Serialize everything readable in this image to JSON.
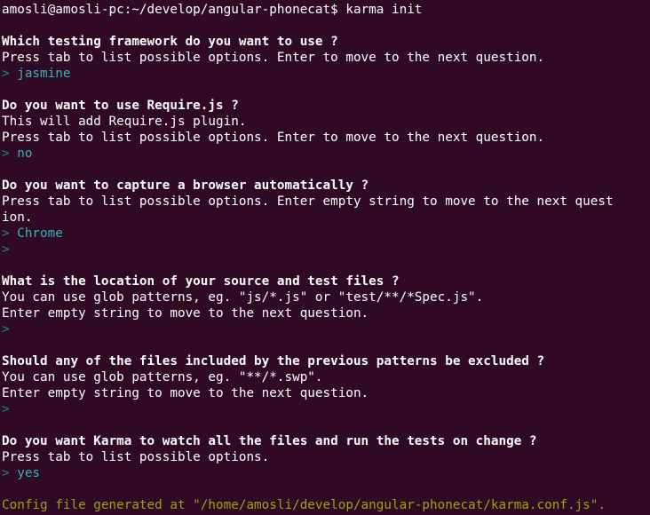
{
  "terminal": {
    "background_color": "#300a24",
    "default_text_color": "#ffffff",
    "bold_text_color": "#ffffff",
    "answer_color": "#34b5b8",
    "prompt_marker_color": "#2a7e86",
    "success_color": "#99a60b",
    "columns": 80,
    "rows": 32,
    "prompt_marker": ">"
  },
  "shell": {
    "prompt": "amosli@amosli-pc:~/develop/angular-phonecat$",
    "command": "karma init",
    "user": "amosli",
    "host": "amosli-pc",
    "cwd": "~/develop/angular-phonecat"
  },
  "lines": [
    {
      "id": "l00",
      "style": "default",
      "text": "amosli@amosli-pc:~/develop/angular-phonecat$ karma init"
    },
    {
      "id": "l01",
      "style": "blank",
      "text": ""
    },
    {
      "id": "l02",
      "style": "bold",
      "text": "Which testing framework do you want to use ?"
    },
    {
      "id": "l03",
      "style": "default",
      "text": "Press tab to list possible options. Enter to move to the next question."
    },
    {
      "id": "l04",
      "style": "answer",
      "marker": "> ",
      "text": "jasmine"
    },
    {
      "id": "l05",
      "style": "blank",
      "text": ""
    },
    {
      "id": "l06",
      "style": "bold",
      "text": "Do you want to use Require.js ?"
    },
    {
      "id": "l07",
      "style": "default",
      "text": "This will add Require.js plugin."
    },
    {
      "id": "l08",
      "style": "default",
      "text": "Press tab to list possible options. Enter to move to the next question."
    },
    {
      "id": "l09",
      "style": "answer",
      "marker": "> ",
      "text": "no"
    },
    {
      "id": "l10",
      "style": "blank",
      "text": ""
    },
    {
      "id": "l11",
      "style": "bold",
      "text": "Do you want to capture a browser automatically ?"
    },
    {
      "id": "l12",
      "style": "default",
      "text": "Press tab to list possible options. Enter empty string to move to the next quest"
    },
    {
      "id": "l13",
      "style": "default",
      "text": "ion."
    },
    {
      "id": "l14",
      "style": "answer",
      "marker": "> ",
      "text": "Chrome"
    },
    {
      "id": "l15",
      "style": "answer",
      "marker": ">",
      "text": ""
    },
    {
      "id": "l16",
      "style": "blank",
      "text": ""
    },
    {
      "id": "l17",
      "style": "bold",
      "text": "What is the location of your source and test files ?"
    },
    {
      "id": "l18",
      "style": "default",
      "text": "You can use glob patterns, eg. \"js/*.js\" or \"test/**/*Spec.js\"."
    },
    {
      "id": "l19",
      "style": "default",
      "text": "Enter empty string to move to the next question."
    },
    {
      "id": "l20",
      "style": "answer",
      "marker": ">",
      "text": ""
    },
    {
      "id": "l21",
      "style": "blank",
      "text": ""
    },
    {
      "id": "l22",
      "style": "bold",
      "text": "Should any of the files included by the previous patterns be excluded ?"
    },
    {
      "id": "l23",
      "style": "default",
      "text": "You can use glob patterns, eg. \"**/*.swp\"."
    },
    {
      "id": "l24",
      "style": "default",
      "text": "Enter empty string to move to the next question."
    },
    {
      "id": "l25",
      "style": "answer",
      "marker": ">",
      "text": ""
    },
    {
      "id": "l26",
      "style": "blank",
      "text": ""
    },
    {
      "id": "l27",
      "style": "bold",
      "text": "Do you want Karma to watch all the files and run the tests on change ?"
    },
    {
      "id": "l28",
      "style": "default",
      "text": "Press tab to list possible options."
    },
    {
      "id": "l29",
      "style": "answer",
      "marker": "> ",
      "text": "yes"
    },
    {
      "id": "l30",
      "style": "blank",
      "text": ""
    },
    {
      "id": "l31",
      "style": "success",
      "text": "Config file generated at \"/home/amosli/develop/angular-phonecat/karma.conf.js\"."
    }
  ],
  "session": {
    "tool": "karma init",
    "questions": [
      {
        "prompt": "Which testing framework do you want to use ?",
        "hint": "Press tab to list possible options. Enter to move to the next question.",
        "answer": "jasmine"
      },
      {
        "prompt": "Do you want to use Require.js ?",
        "hint": "This will add Require.js plugin.",
        "hint2": "Press tab to list possible options. Enter to move to the next question.",
        "answer": "no"
      },
      {
        "prompt": "Do you want to capture a browser automatically ?",
        "hint": "Press tab to list possible options. Enter empty string to move to the next question.",
        "answer": "Chrome"
      },
      {
        "prompt": "What is the location of your source and test files ?",
        "hint": "You can use glob patterns, eg. \"js/*.js\" or \"test/**/*Spec.js\".",
        "hint2": "Enter empty string to move to the next question.",
        "answer": ""
      },
      {
        "prompt": "Should any of the files included by the previous patterns be excluded ?",
        "hint": "You can use glob patterns, eg. \"**/*.swp\".",
        "hint2": "Enter empty string to move to the next question.",
        "answer": ""
      },
      {
        "prompt": "Do you want Karma to watch all the files and run the tests on change ?",
        "hint": "Press tab to list possible options.",
        "answer": "yes"
      }
    ],
    "result": "Config file generated at \"/home/amosli/develop/angular-phonecat/karma.conf.js\"."
  }
}
